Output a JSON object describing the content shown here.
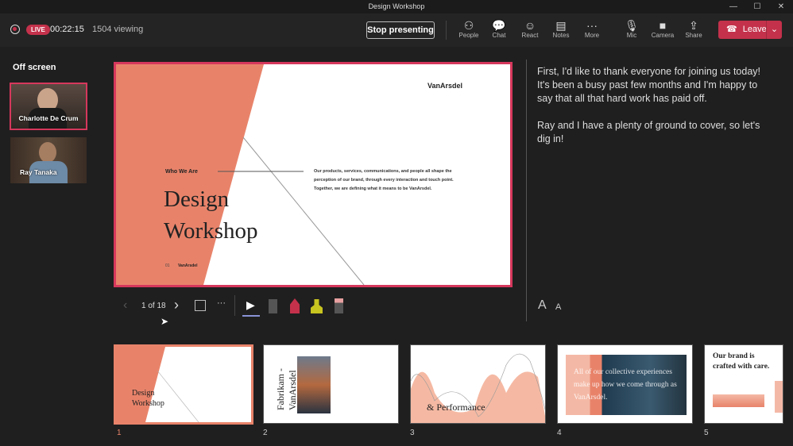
{
  "window": {
    "title": "Design Workshop",
    "minimize": "—",
    "maximize": "☐",
    "close": "✕"
  },
  "header": {
    "live": "LIVE",
    "elapsed": "00:22:15",
    "viewers": "1504 viewing",
    "stop_presenting": "Stop presenting",
    "tools": [
      {
        "label": "People",
        "icon": "people-icon",
        "glyph": "⚇"
      },
      {
        "label": "Chat",
        "icon": "chat-icon",
        "glyph": "💬"
      },
      {
        "label": "React",
        "icon": "react-icon",
        "glyph": "☺"
      },
      {
        "label": "Notes",
        "icon": "notes-icon",
        "glyph": "▤"
      },
      {
        "label": "More",
        "icon": "more-icon",
        "glyph": "···"
      },
      {
        "label": "Mic",
        "icon": "mic-icon",
        "glyph": "🎙"
      },
      {
        "label": "Camera",
        "icon": "camera-icon",
        "glyph": "■"
      },
      {
        "label": "Share",
        "icon": "share-icon",
        "glyph": "⇪"
      }
    ],
    "leave": "Leave",
    "accent": "#c4314b"
  },
  "sidebar": {
    "title": "Off screen",
    "participants": [
      {
        "name": "Charlotte De Crum"
      },
      {
        "name": "Ray Tanaka"
      }
    ]
  },
  "slide": {
    "brand": "VanArsdel",
    "kicker": "Who We Are",
    "title_line1": "Design",
    "title_line2": "Workshop",
    "body": "Our products, services, communications, and people all shape the perception of our brand, through every interaction and touch point. Together, we are defining what it means to be VanArsdel.",
    "footer_num": "01",
    "footer_brand": "VanArsdel",
    "accent": "#e8836a"
  },
  "controls": {
    "page": "1 of 18",
    "font_up": "A",
    "font_down": "A"
  },
  "notes": [
    "First, I'd like to thank everyone for joining us today! It's been a busy past few months and I'm happy to say that all that hard work has paid off.",
    "Ray and I have a plenty of ground to cover, so let's dig in!"
  ],
  "thumbnails": [
    {
      "num": "1",
      "text": "Design Workshop"
    },
    {
      "num": "2",
      "text": "Fabrikam - VanArsdel"
    },
    {
      "num": "3",
      "text": "& Performance"
    },
    {
      "num": "4",
      "text": "All of our collective experiences make up how we come through as VanArsdel."
    },
    {
      "num": "5",
      "text": "Our brand is crafted with care."
    }
  ]
}
